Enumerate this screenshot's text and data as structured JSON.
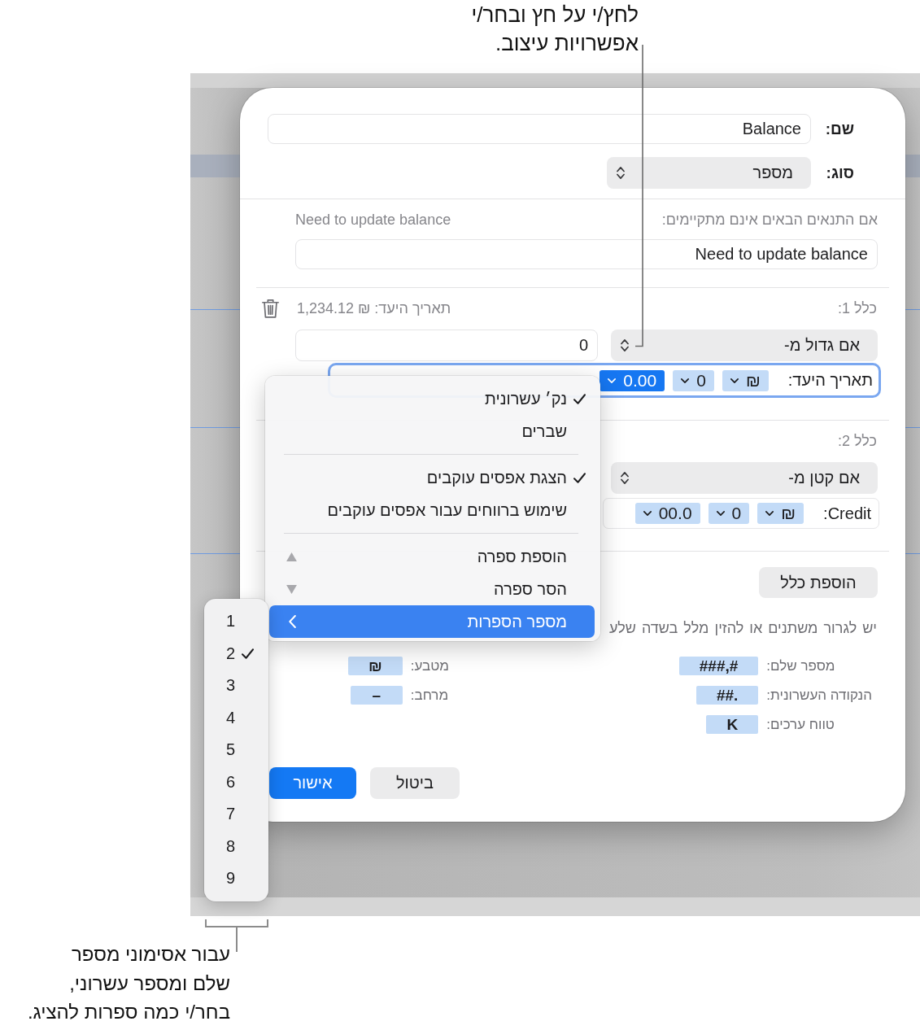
{
  "annotations": {
    "top": "לחץ/י על חץ ובחר/י\nאפשרויות עיצוב.",
    "bottom": "עבור אסימוני מספר\nשלם ומספר עשרוני,\nבחר/י כמה ספרות להציג."
  },
  "dialog": {
    "name_field": {
      "label": "שם:",
      "value": "Balance"
    },
    "type_field": {
      "label": "סוג:",
      "value": "מספר"
    },
    "fallback": {
      "label": "אם התנאים הבאים אינם מתקיימים:",
      "preview": "Need to update balance",
      "value": "Need to update balance"
    },
    "rules": [
      {
        "label": "כלל 1:",
        "preview": "תאריך היעד: ₪ 1,234.12",
        "condition": "אם גדול מ-",
        "operand": "0",
        "format": {
          "focused": true,
          "prefix": "תאריך היעד:",
          "tokens": [
            {
              "text": "₪",
              "selected": false
            },
            {
              "text": "0",
              "selected": false
            },
            {
              "text": "0.00",
              "selected": true
            }
          ]
        }
      },
      {
        "label": "כלל 2:",
        "condition": "אם קטן מ-",
        "format": {
          "focused": false,
          "prefix": ":Credit",
          "tokens": [
            {
              "text": "₪",
              "selected": false
            },
            {
              "text": "0",
              "selected": false
            },
            {
              "text": "00.0",
              "selected": false
            }
          ]
        }
      }
    ],
    "add_rule_button": "הוספת כלל",
    "help_text": "יש לגרור משתנים או להזין מלל בשדה שלע",
    "legend": [
      [
        {
          "label": "מספר שלם:",
          "token": "###,#"
        },
        {
          "label": "הנקודה העשרונית:",
          "token": "##."
        },
        {
          "label": "טווח ערכים:",
          "token": "K"
        }
      ],
      [
        {
          "label": "מטבע:",
          "token": "₪"
        },
        {
          "label": "מרחב:",
          "token": "–"
        }
      ]
    ],
    "buttons": [
      {
        "label": "ביטול",
        "kind": "secondary"
      },
      {
        "label": "אישור",
        "kind": "primary"
      }
    ]
  },
  "format_menu": {
    "groups": [
      {
        "items": [
          {
            "kind": "check",
            "label": "נק׳ עשרונית",
            "checked": true,
            "selected": false
          },
          {
            "kind": "check",
            "label": "שברים",
            "checked": false,
            "selected": false
          }
        ]
      },
      {
        "items": [
          {
            "kind": "check",
            "label": "הצגת אפסים עוקבים",
            "checked": true,
            "selected": false
          },
          {
            "kind": "check",
            "label": "שימוש ברווחים עבור אפסים עוקבים",
            "checked": false,
            "selected": false
          }
        ]
      },
      {
        "items": [
          {
            "kind": "increment",
            "label": "הוספת ספרה",
            "selected": false
          },
          {
            "kind": "decrement",
            "label": "הסר ספרה",
            "selected": false
          },
          {
            "kind": "submenu",
            "label": "מספר הספרות",
            "selected": true
          }
        ]
      }
    ]
  },
  "digits_menu": {
    "items": [
      {
        "label": "1",
        "checked": false
      },
      {
        "label": "2",
        "checked": true
      },
      {
        "label": "3",
        "checked": false
      },
      {
        "label": "4",
        "checked": false
      },
      {
        "label": "5",
        "checked": false
      },
      {
        "label": "6",
        "checked": false
      },
      {
        "label": "7",
        "checked": false
      },
      {
        "label": "8",
        "checked": false
      },
      {
        "label": "9",
        "checked": false
      }
    ]
  }
}
